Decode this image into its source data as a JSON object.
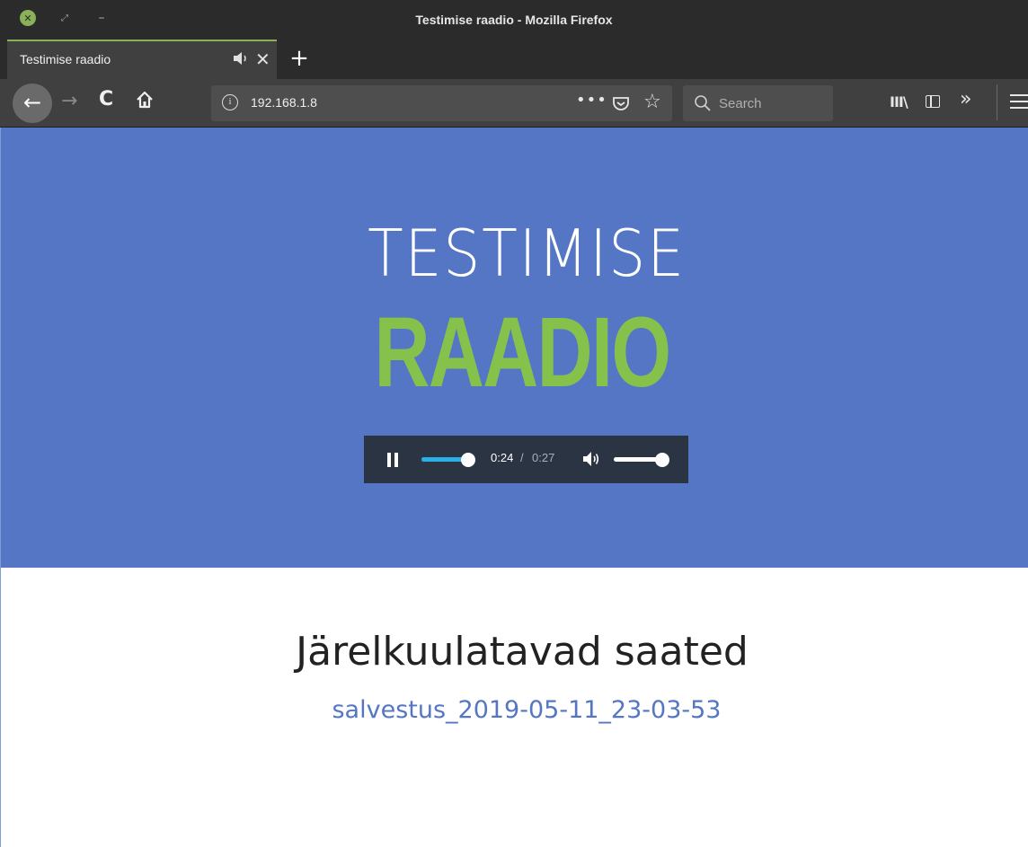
{
  "window": {
    "title": "Testimise raadio - Mozilla Firefox",
    "close_glyph": "✕",
    "maximize_glyph": "⤢",
    "minimize_glyph": "–"
  },
  "tabs": [
    {
      "label": "Testimise raadio",
      "active": true,
      "audio_icon": "speaker-icon"
    }
  ],
  "tab_controls": {
    "close_glyph": "✕",
    "new_tab_glyph": "+"
  },
  "nav": {
    "back_glyph": "←",
    "forward_glyph": "→",
    "reload_glyph": "C",
    "url": "192.168.1.8",
    "page_actions_glyph": "•••",
    "bookmark_glyph": "☆",
    "search_placeholder": "Search",
    "library_glyph": "III\\",
    "overflow_glyph": "»"
  },
  "page": {
    "hero_color": "#5476c4",
    "logo": {
      "line1": "TESTIMISE",
      "line2": "RAADIO",
      "line1_color": "#ffffff",
      "line2_color": "#86c14c"
    },
    "player": {
      "state": "playing",
      "current_time": "0:24",
      "separator": "/",
      "total_time": "0:27",
      "progress": 0.889,
      "volume": 1.0,
      "seek_color": "#2ab0e8"
    },
    "section_title": "Järelkuulatavad saated",
    "recordings": [
      {
        "name": "salvestus_2019-05-11_23-03-53"
      }
    ],
    "link_color": "#5476c4"
  }
}
